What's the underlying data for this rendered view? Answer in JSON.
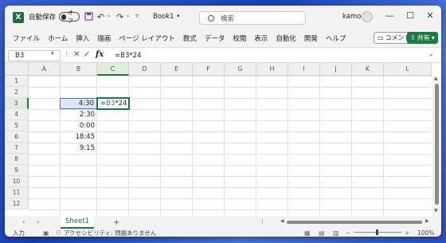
{
  "title": {
    "autosave_label": "自動保存",
    "autosave_state": "オフ",
    "filename": "Book1",
    "filename_suffix": "•",
    "search_placeholder": "検索",
    "user": "kamo"
  },
  "menu": [
    "ファイル",
    "ホーム",
    "挿入",
    "描画",
    "ページ レイアウト",
    "数式",
    "データ",
    "校閲",
    "表示",
    "自動化",
    "開発",
    "ヘルプ"
  ],
  "buttons": {
    "comment": "コメント",
    "share": "共有"
  },
  "formula_bar": {
    "name_box": "B3",
    "formula": "=B3*24",
    "fx": "fx"
  },
  "columns": [
    "A",
    "B",
    "C",
    "D",
    "E",
    "F",
    "G",
    "H",
    "I",
    "J",
    "K",
    "L"
  ],
  "rows": [
    "1",
    "2",
    "3",
    "4",
    "5",
    "6",
    "7",
    "8",
    "9",
    "10",
    "11",
    "12"
  ],
  "cells": {
    "B3": "4:30",
    "B4": "2:30",
    "B5": "0:00",
    "B6": "18:45",
    "B7": "9:15",
    "C3_prefix": "=",
    "C3_ref": "B3",
    "C3_suffix": "*24"
  },
  "sheet": {
    "tab": "Sheet1",
    "add": "+"
  },
  "status": {
    "mode": "入力",
    "accessibility": "アクセシビリティ: 問題ありません",
    "zoom": "100%"
  },
  "icons": [
    "excel-logo-icon",
    "save-icon",
    "undo-icon",
    "redo-icon",
    "search-icon",
    "minimize-icon",
    "maximize-icon",
    "close-icon",
    "cancel-icon",
    "enter-icon",
    "fx-icon"
  ]
}
